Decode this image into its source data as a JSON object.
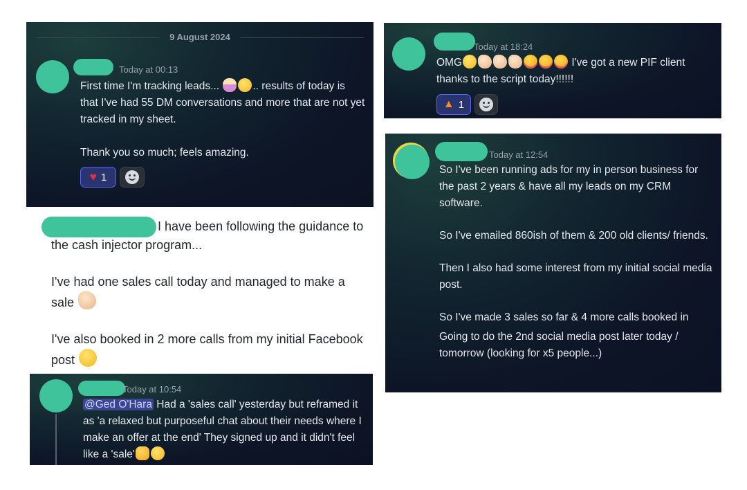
{
  "card1": {
    "date": "9 August 2024",
    "timestamp": "Today at 00:13",
    "lines": [
      "First time I'm tracking leads...",
      ".. results of today is that I've had 55 DM conversations and more that are not yet tracked in my sheet.",
      "Thank you so much; feels amazing."
    ],
    "reaction_count": "1",
    "icons": [
      "woman-tipping-hand-emoji",
      "smiling-face-emoji",
      "heart-reaction-icon",
      "add-reaction-icon"
    ]
  },
  "card2": {
    "timestamp": "Today at 18:24",
    "prefix": "OMG",
    "suffix": "I've got a new PIF client thanks to the script today!!!!!!",
    "reaction_count": "1",
    "icons": [
      "grinning-face-emoji",
      "clapping-hands-emoji",
      "partying-face-emoji",
      "fire-reaction-icon",
      "add-reaction-icon"
    ]
  },
  "card3": {
    "timestamp": "Today at 12:54",
    "paragraphs": [
      "So I've been running ads for my in person business for the past 2 years & have all my leads on my CRM software.",
      "So I've emailed 860ish of them & 200 old clients/ friends.",
      "Then I also had some interest from my initial social media post.",
      "So I've made 3 sales so far &  4 more calls booked in",
      "Going to do the 2nd social media post later today / tomorrow (looking for x5 people...)"
    ]
  },
  "white": {
    "paragraphs": [
      "I have been following the guidance to the cash injector program...",
      "I've had one sales call today and managed to make a sale",
      "I've also booked in 2 more calls from my initial Facebook post"
    ],
    "icons": [
      "raising-hands-emoji",
      "grinning-squinting-face-emoji"
    ]
  },
  "card4": {
    "timestamp": "Today at 10:54",
    "mention": "@Ged O'Hara",
    "text": "Had a 'sales call' yesterday but reframed it as 'a relaxed but purposeful chat about their needs where I make an offer at the end' They signed up and it didn't feel like a 'sale'",
    "icons": [
      "thumbs-up-emoji",
      "slightly-smiling-face-emoji"
    ]
  },
  "colors": {
    "avatar": "#3ec39b",
    "card_bg": "#0d1526",
    "mention_bg": "#3c4690",
    "reaction_active_border": "#5865f2"
  }
}
